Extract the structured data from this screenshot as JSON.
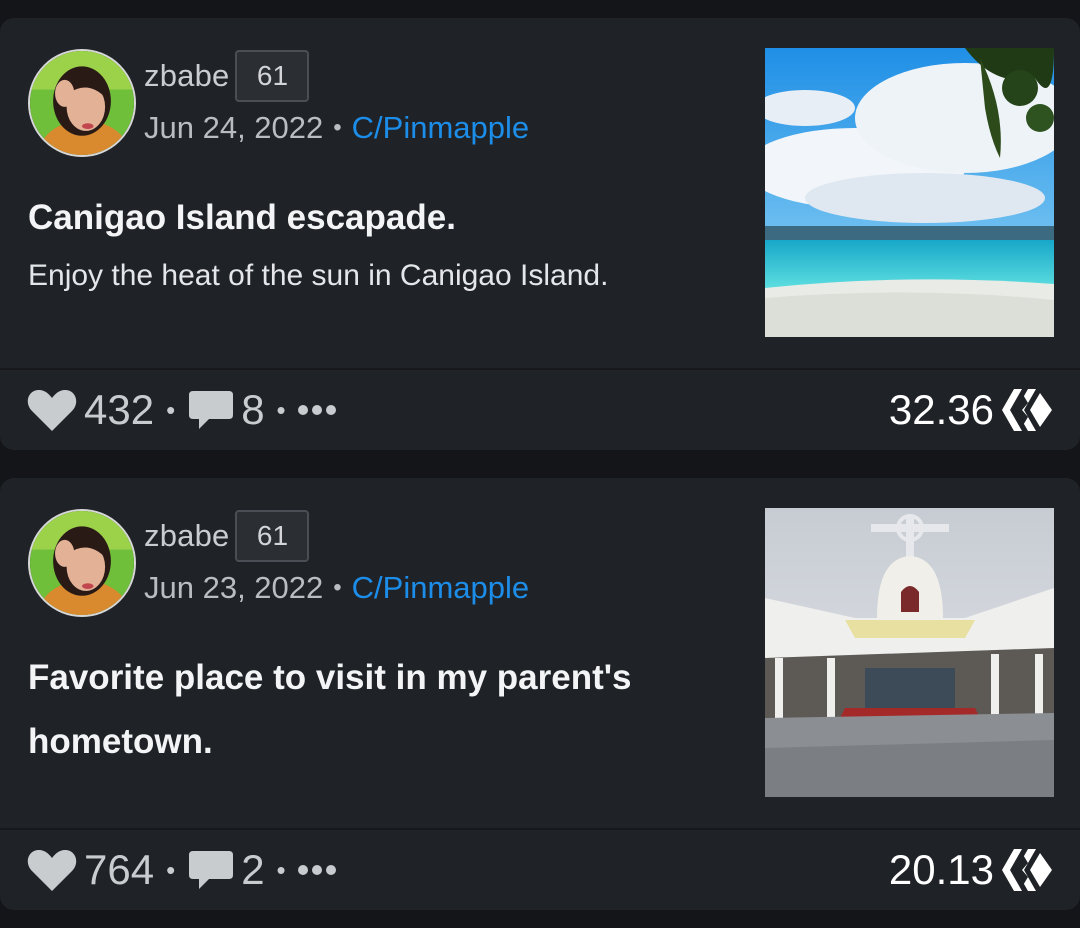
{
  "posts": [
    {
      "author": "zbabe",
      "reputation": "61",
      "date": "Jun 24, 2022",
      "separator": "•",
      "community": "C/Pinmapple",
      "title": "Canigao Island escapade.",
      "excerpt": "Enjoy the heat of the sun in Canigao Island.",
      "votes": "432",
      "comments": "8",
      "payout": "32.36",
      "thumbnail": "beach-photo"
    },
    {
      "author": "zbabe",
      "reputation": "61",
      "date": "Jun 23, 2022",
      "separator": "•",
      "community": "C/Pinmapple",
      "title": "Favorite place to visit in my parent's hometown.",
      "excerpt": "",
      "votes": "764",
      "comments": "2",
      "payout": "20.13",
      "thumbnail": "church-photo"
    }
  ],
  "icons": {
    "vote": "heart-icon",
    "comments": "comment-icon",
    "more": "more-icon",
    "currency": "hive-icon"
  },
  "colors": {
    "background": "#141518",
    "card": "#1f2226",
    "community_link": "#1c8ee9",
    "hive_red": "#e31337"
  }
}
